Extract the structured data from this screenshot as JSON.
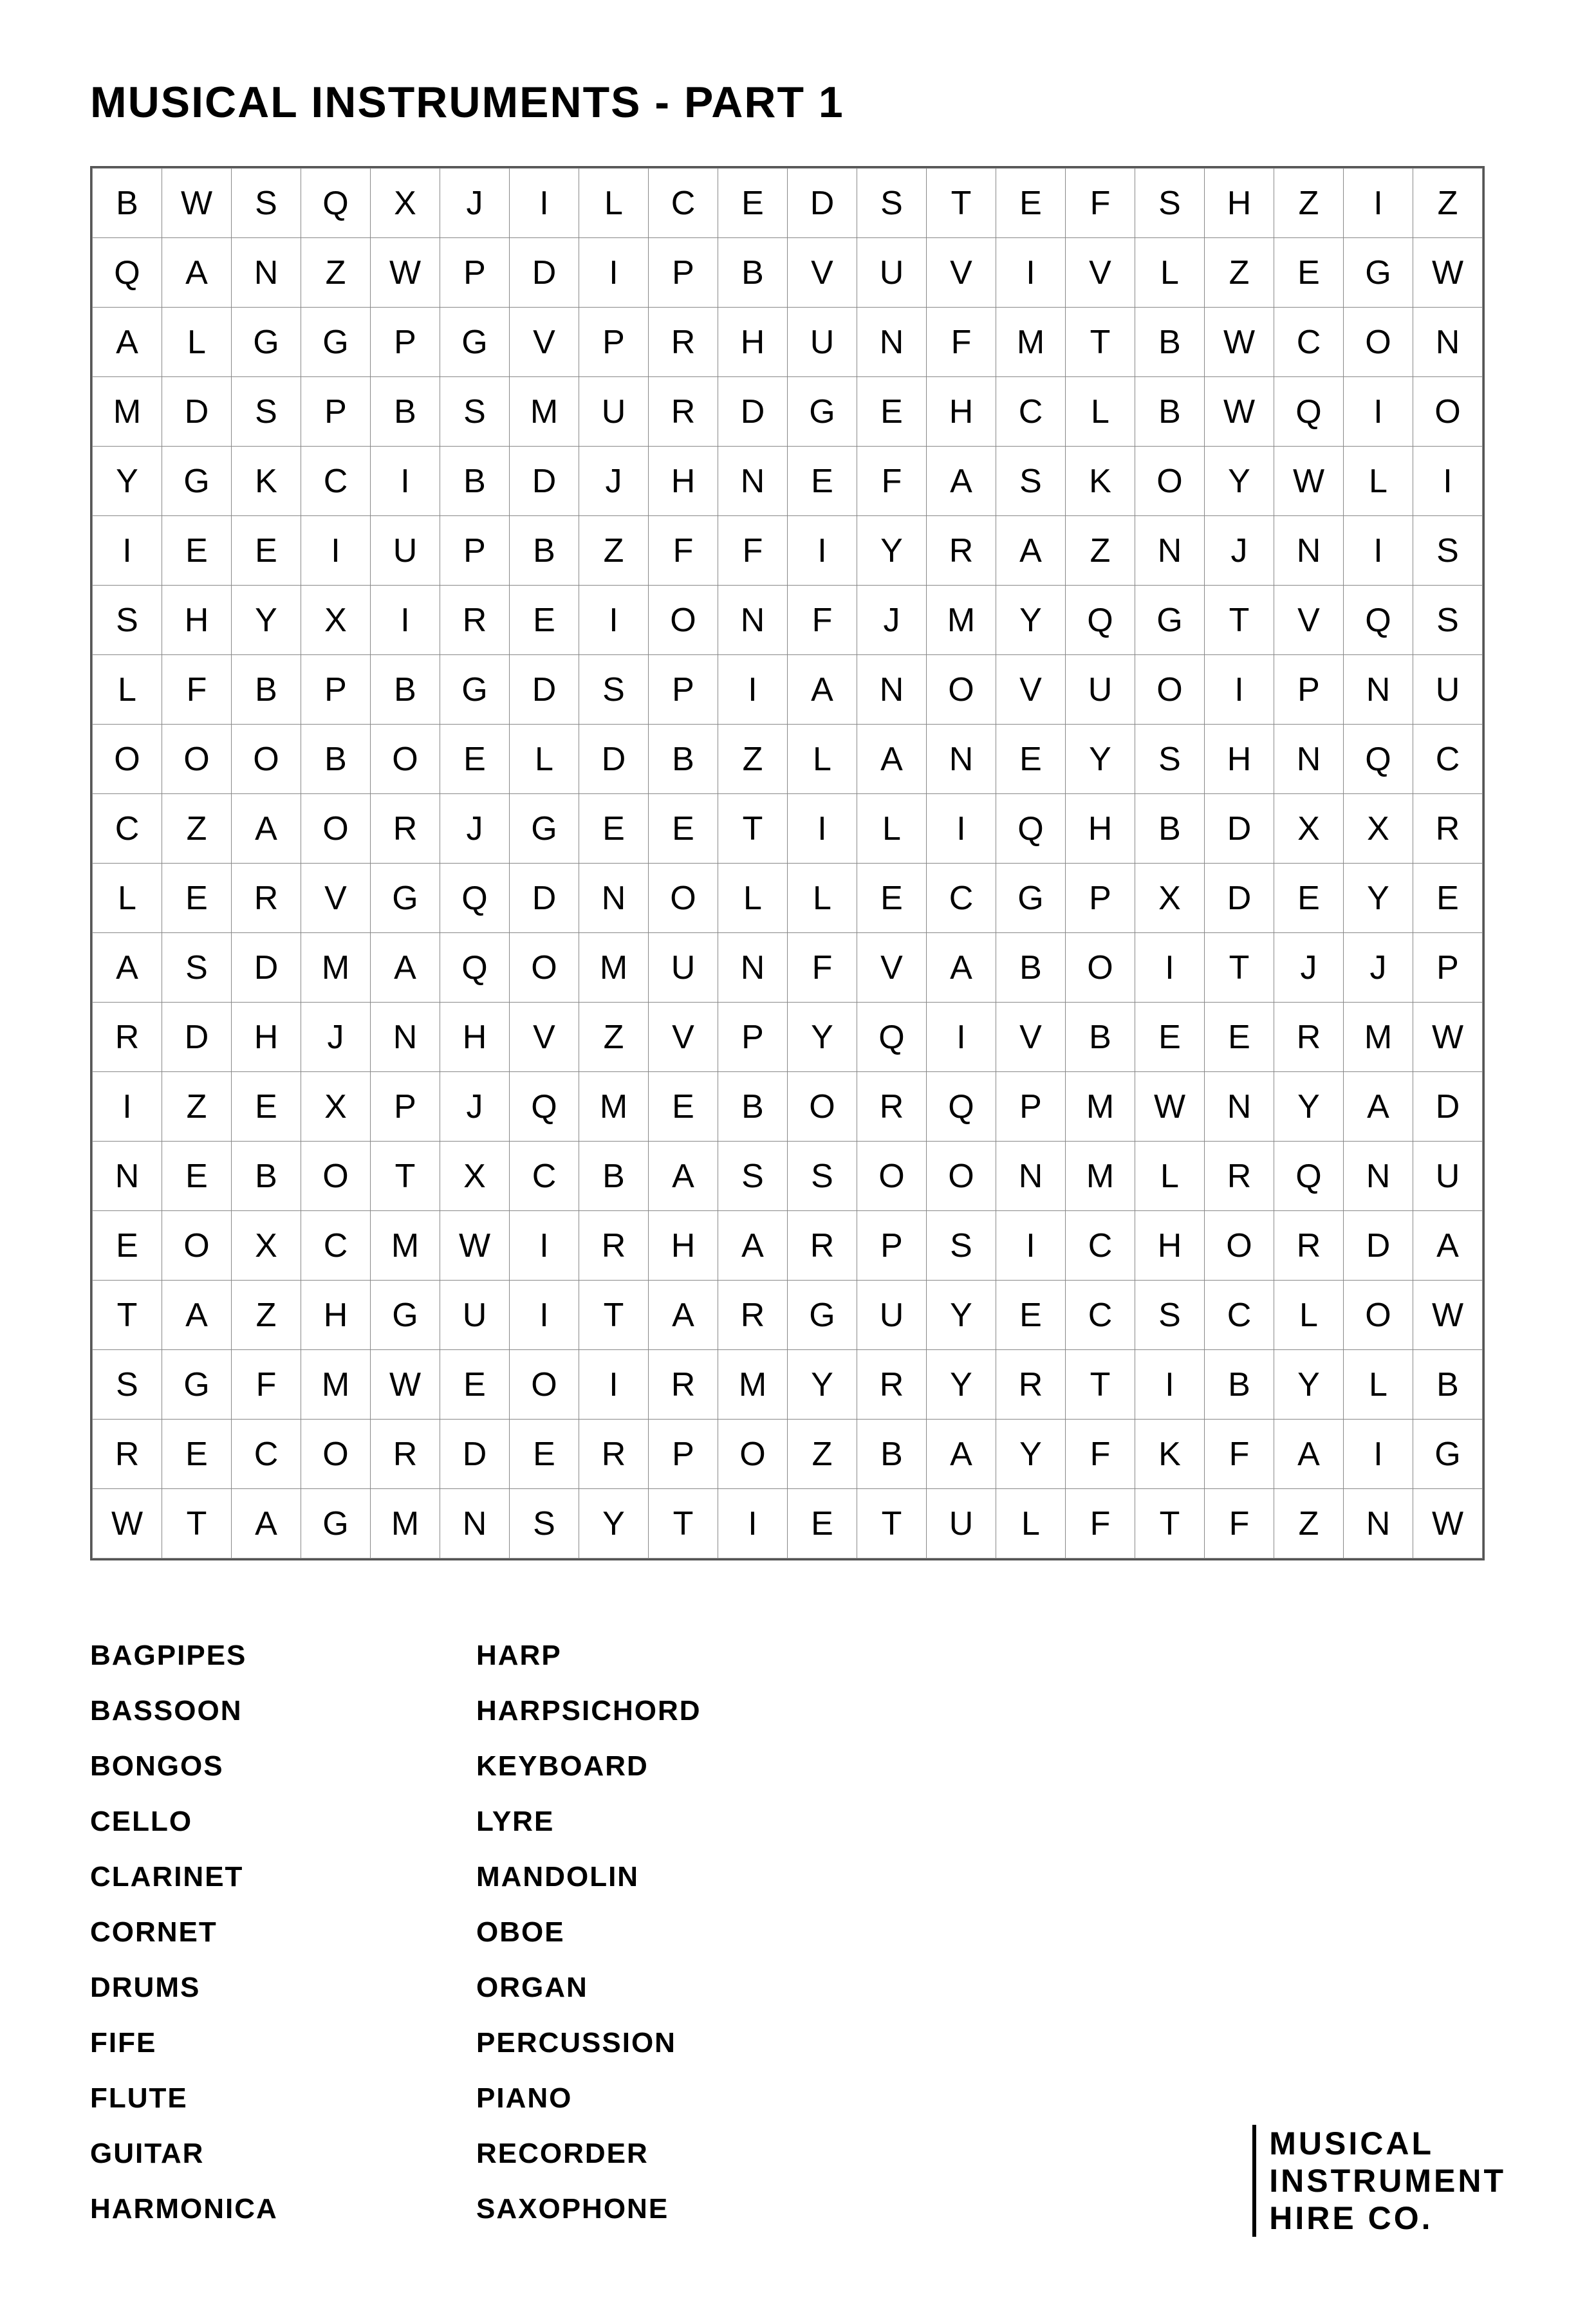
{
  "title": "MUSICAL INSTRUMENTS - PART 1",
  "grid": {
    "rows": [
      [
        "B",
        "W",
        "S",
        "Q",
        "X",
        "J",
        "I",
        "L",
        "C",
        "E",
        "D",
        "S",
        "T",
        "E",
        "F",
        "S",
        "H",
        "Z",
        "I",
        "Z"
      ],
      [
        "Q",
        "A",
        "N",
        "Z",
        "W",
        "P",
        "D",
        "I",
        "P",
        "B",
        "V",
        "U",
        "V",
        "I",
        "V",
        "L",
        "Z",
        "E",
        "G",
        "W"
      ],
      [
        "A",
        "L",
        "G",
        "G",
        "P",
        "G",
        "V",
        "P",
        "R",
        "H",
        "U",
        "N",
        "F",
        "M",
        "T",
        "B",
        "W",
        "C",
        "O",
        "N"
      ],
      [
        "M",
        "D",
        "S",
        "P",
        "B",
        "S",
        "M",
        "U",
        "R",
        "D",
        "G",
        "E",
        "H",
        "C",
        "L",
        "B",
        "W",
        "Q",
        "I",
        "O"
      ],
      [
        "Y",
        "G",
        "K",
        "C",
        "I",
        "B",
        "D",
        "J",
        "H",
        "N",
        "E",
        "F",
        "A",
        "S",
        "K",
        "O",
        "Y",
        "W",
        "L",
        "I"
      ],
      [
        "I",
        "E",
        "E",
        "I",
        "U",
        "P",
        "B",
        "Z",
        "F",
        "F",
        "I",
        "Y",
        "R",
        "A",
        "Z",
        "N",
        "J",
        "N",
        "I",
        "S"
      ],
      [
        "S",
        "H",
        "Y",
        "X",
        "I",
        "R",
        "E",
        "I",
        "O",
        "N",
        "F",
        "J",
        "M",
        "Y",
        "Q",
        "G",
        "T",
        "V",
        "Q",
        "S"
      ],
      [
        "L",
        "F",
        "B",
        "P",
        "B",
        "G",
        "D",
        "S",
        "P",
        "I",
        "A",
        "N",
        "O",
        "V",
        "U",
        "O",
        "I",
        "P",
        "N",
        "U"
      ],
      [
        "O",
        "O",
        "O",
        "B",
        "O",
        "E",
        "L",
        "D",
        "B",
        "Z",
        "L",
        "A",
        "N",
        "E",
        "Y",
        "S",
        "H",
        "N",
        "Q",
        "C"
      ],
      [
        "C",
        "Z",
        "A",
        "O",
        "R",
        "J",
        "G",
        "E",
        "E",
        "T",
        "I",
        "L",
        "I",
        "Q",
        "H",
        "B",
        "D",
        "X",
        "X",
        "R"
      ],
      [
        "L",
        "E",
        "R",
        "V",
        "G",
        "Q",
        "D",
        "N",
        "O",
        "L",
        "L",
        "E",
        "C",
        "G",
        "P",
        "X",
        "D",
        "E",
        "Y",
        "E"
      ],
      [
        "A",
        "S",
        "D",
        "M",
        "A",
        "Q",
        "O",
        "M",
        "U",
        "N",
        "F",
        "V",
        "A",
        "B",
        "O",
        "I",
        "T",
        "J",
        "J",
        "P"
      ],
      [
        "R",
        "D",
        "H",
        "J",
        "N",
        "H",
        "V",
        "Z",
        "V",
        "P",
        "Y",
        "Q",
        "I",
        "V",
        "B",
        "E",
        "E",
        "R",
        "M",
        "W"
      ],
      [
        "I",
        "Z",
        "E",
        "X",
        "P",
        "J",
        "Q",
        "M",
        "E",
        "B",
        "O",
        "R",
        "Q",
        "P",
        "M",
        "W",
        "N",
        "Y",
        "A",
        "D"
      ],
      [
        "N",
        "E",
        "B",
        "O",
        "T",
        "X",
        "C",
        "B",
        "A",
        "S",
        "S",
        "O",
        "O",
        "N",
        "M",
        "L",
        "R",
        "Q",
        "N",
        "U"
      ],
      [
        "E",
        "O",
        "X",
        "C",
        "M",
        "W",
        "I",
        "R",
        "H",
        "A",
        "R",
        "P",
        "S",
        "I",
        "C",
        "H",
        "O",
        "R",
        "D",
        "A"
      ],
      [
        "T",
        "A",
        "Z",
        "H",
        "G",
        "U",
        "I",
        "T",
        "A",
        "R",
        "G",
        "U",
        "Y",
        "E",
        "C",
        "S",
        "C",
        "L",
        "O",
        "W"
      ],
      [
        "S",
        "G",
        "F",
        "M",
        "W",
        "E",
        "O",
        "I",
        "R",
        "M",
        "Y",
        "R",
        "Y",
        "R",
        "T",
        "I",
        "B",
        "Y",
        "L",
        "B"
      ],
      [
        "R",
        "E",
        "C",
        "O",
        "R",
        "D",
        "E",
        "R",
        "P",
        "O",
        "Z",
        "B",
        "A",
        "Y",
        "F",
        "K",
        "F",
        "A",
        "I",
        "G"
      ],
      [
        "W",
        "T",
        "A",
        "G",
        "M",
        "N",
        "S",
        "Y",
        "T",
        "I",
        "E",
        "T",
        "U",
        "L",
        "F",
        "T",
        "F",
        "Z",
        "N",
        "W"
      ]
    ]
  },
  "word_list": {
    "column1": [
      "BAGPIPES",
      "BASSOON",
      "BONGOS",
      "CELLO",
      "CLARINET",
      "CORNET",
      "DRUMS",
      "FIFE",
      "FLUTE",
      "GUITAR",
      "HARMONICA"
    ],
    "column2": [
      "HARP",
      "HARPSICHORD",
      "KEYBOARD",
      "LYRE",
      "MANDOLIN",
      "OBOE",
      "ORGAN",
      "PERCUSSION",
      "PIANO",
      "RECORDER",
      "SAXOPHONE"
    ]
  },
  "logo": {
    "line1": "MUSICAL",
    "line2": "INSTRUMENT",
    "line3": "HIRE CO."
  }
}
